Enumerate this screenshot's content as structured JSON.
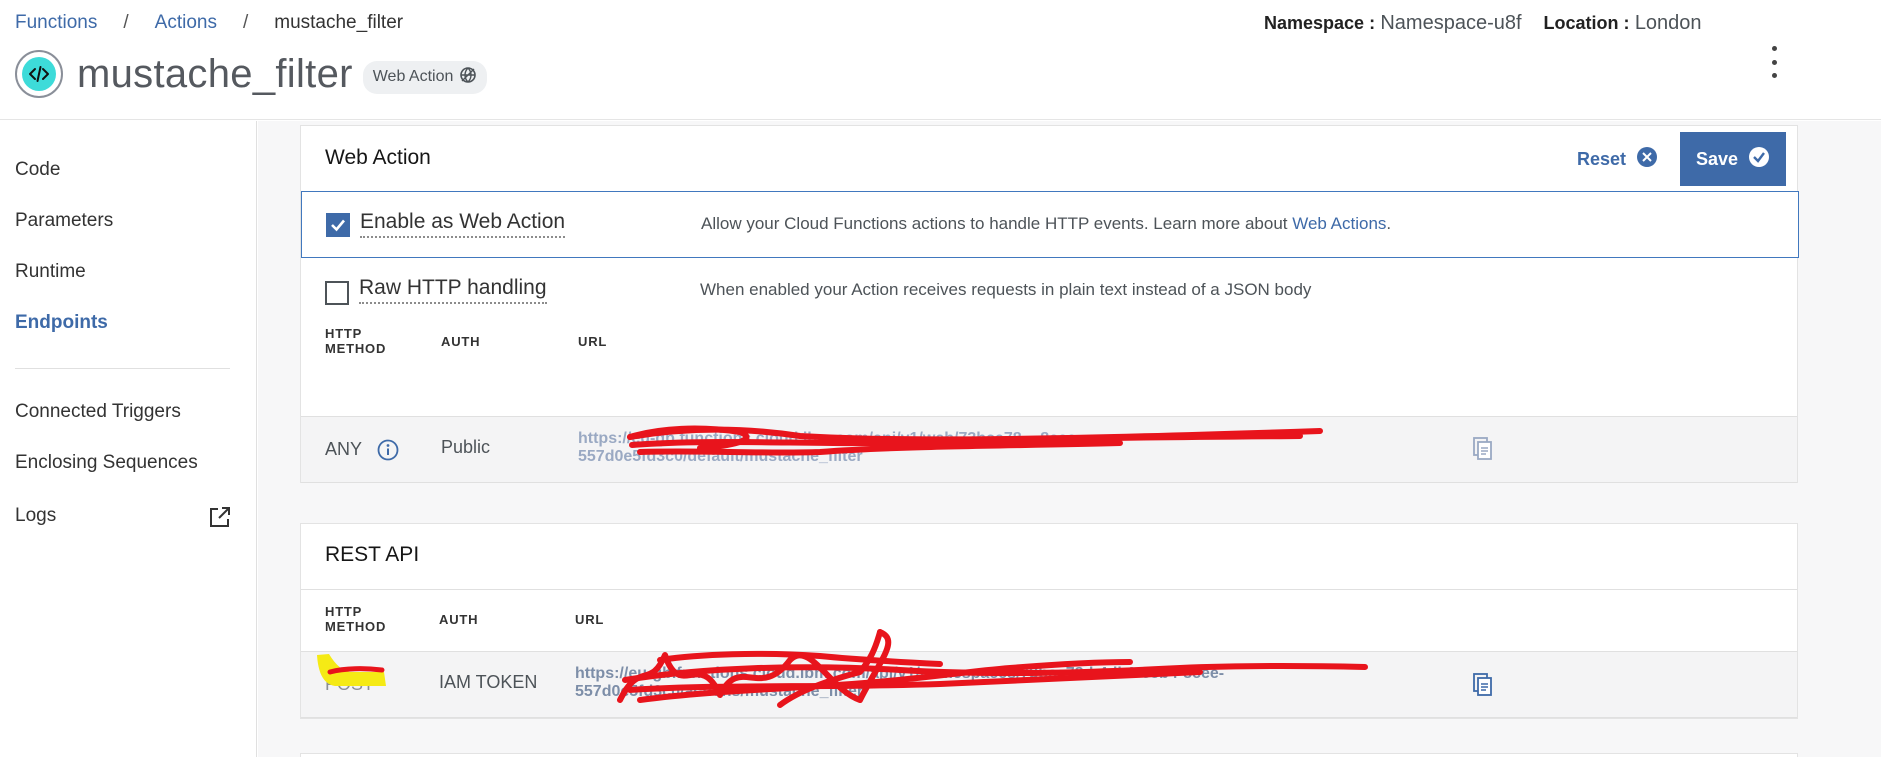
{
  "breadcrumb": {
    "items": [
      "Functions",
      "Actions"
    ],
    "separator": "/",
    "current": "mustache_filter"
  },
  "header": {
    "title": "mustache_filter",
    "tag": "Web Action",
    "namespace_label": "Namespace :",
    "namespace_value": "Namespace-u8f",
    "location_label": "Location :",
    "location_value": "London"
  },
  "sidebar": {
    "items": [
      {
        "label": "Code"
      },
      {
        "label": "Parameters"
      },
      {
        "label": "Runtime"
      },
      {
        "label": "Endpoints",
        "active": true
      },
      {
        "label": "Connected Triggers"
      },
      {
        "label": "Enclosing Sequences"
      },
      {
        "label": "Logs"
      }
    ]
  },
  "web_action": {
    "title": "Web Action",
    "reset_label": "Reset",
    "save_label": "Save",
    "enable": {
      "label": "Enable as Web Action",
      "checked": true,
      "description": "Allow your Cloud Functions actions to handle HTTP events. Learn more about ",
      "link": "Web Actions",
      "description_end": "."
    },
    "raw": {
      "label": "Raw HTTP handling",
      "checked": false,
      "description": "When enabled your Action receives requests in plain text instead of a JSON body"
    },
    "table": {
      "headers": [
        "HTTP METHOD",
        "AUTH",
        "URL"
      ],
      "header_method_line1": "HTTP",
      "header_method_line2": "METHOD",
      "row": {
        "method": "ANY",
        "auth": "Public",
        "url_line1": "https://eu-gb.functions.cloud.ibm.com/api/v1/web/73bce78...-8cee-",
        "url_line2": "557d0e5fd3c0/default/mustache_filter"
      }
    }
  },
  "rest_api": {
    "title": "REST API",
    "table": {
      "header_method_line1": "HTTP",
      "header_method_line2": "METHOD",
      "header_auth": "AUTH",
      "header_url": "URL",
      "row": {
        "method": "POST",
        "auth": "IAM TOKEN",
        "url_line1": "https://eu-gb.functions.cloud.ibm.com/api/v1/namespaces/73bce78d-4db0-85b4-8cee-",
        "url_line2": "557d0e5fd3c0/actions/mustache_filter"
      }
    }
  },
  "colors": {
    "accent": "#3e6aa8",
    "teal": "#3ddbd9",
    "redaction": "#e8141c",
    "highlight": "#f5ea15"
  },
  "icons": [
    "code-icon",
    "web-action-icon",
    "kebab-menu-icon",
    "external-link-icon",
    "close-circle-icon",
    "checkmark-circle-icon",
    "info-icon",
    "copy-icon"
  ]
}
